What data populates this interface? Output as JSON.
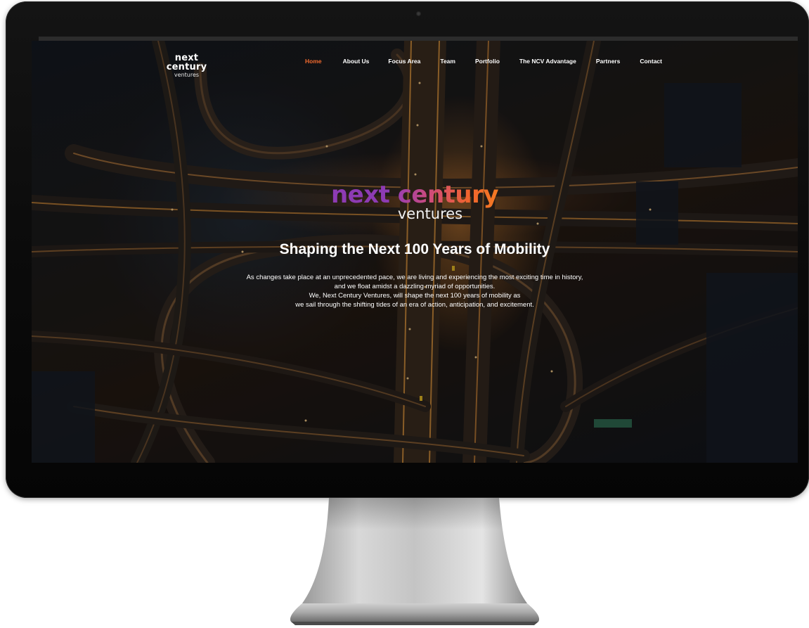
{
  "site": {
    "brand": {
      "line1": "next century",
      "line2": "ventures"
    },
    "nav": [
      {
        "label": "Home",
        "active": true
      },
      {
        "label": "About Us",
        "active": false
      },
      {
        "label": "Focus Area",
        "active": false
      },
      {
        "label": "Team",
        "active": false
      },
      {
        "label": "Portfolio",
        "active": false
      },
      {
        "label": "The NCV Advantage",
        "active": false
      },
      {
        "label": "Partners",
        "active": false
      },
      {
        "label": "Contact",
        "active": false
      }
    ],
    "hero": {
      "logo_word1": "next",
      "logo_word2": "century",
      "logo_sub": "ventures",
      "headline": "Shaping the Next 100 Years of Mobility",
      "paragraph": [
        "As changes take place at an unprecedented pace, we are living and experiencing the most exciting time in history,",
        "and we float amidst a dazzling myriad of opportunities.",
        "We, Next Century Ventures, will shape the next 100 years of mobility as",
        "we sail through the shifting tides of an era of action, anticipation, and excitement."
      ]
    }
  },
  "colors": {
    "accent_orange": "#f26a2e",
    "logo_purple": "#8d3bb3",
    "bezel": "#0b0b0b",
    "text": "#ffffff"
  }
}
